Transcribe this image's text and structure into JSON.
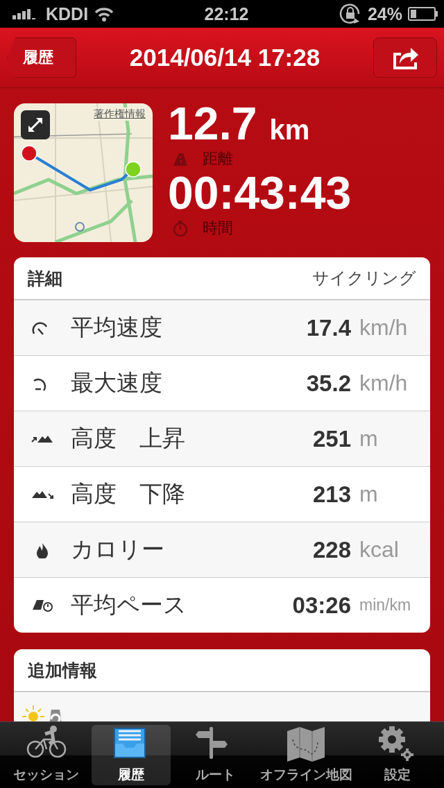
{
  "status_bar": {
    "carrier": "KDDI",
    "time": "22:12",
    "battery": "24%"
  },
  "nav": {
    "back": "履歴",
    "title": "2014/06/14 17:28"
  },
  "summary": {
    "map": {
      "credit": "著作権情報"
    },
    "stats": [
      {
        "kind": "distance",
        "value": "12.7",
        "unit": "km",
        "label": "距離"
      },
      {
        "kind": "time",
        "value": "00:43:43",
        "label": "時間"
      }
    ]
  },
  "details": {
    "title": "詳細",
    "activity": "サイクリング",
    "rows": [
      {
        "kind": "avg-speed",
        "label": "平均速度",
        "value": "17.4",
        "unit": "km/h"
      },
      {
        "kind": "max-speed",
        "label": "最大速度",
        "value": "35.2",
        "unit": "km/h"
      },
      {
        "kind": "ascent",
        "label": "高度　上昇",
        "value": "251",
        "unit": "m"
      },
      {
        "kind": "descent",
        "label": "高度　下降",
        "value": "213",
        "unit": "m"
      },
      {
        "kind": "calories",
        "label": "カロリー",
        "value": "228",
        "unit": "kcal"
      },
      {
        "kind": "pace",
        "label": "平均ペース",
        "value": "03:26",
        "unit": "min/km"
      }
    ]
  },
  "extra": {
    "title": "追加情報"
  },
  "tab_bar": [
    {
      "kind": "session",
      "label": "セッション",
      "selected": false
    },
    {
      "kind": "history",
      "label": "履歴",
      "selected": true
    },
    {
      "kind": "route",
      "label": "ルート",
      "selected": false
    },
    {
      "kind": "offline-map",
      "label": "オフライン地図",
      "selected": false
    },
    {
      "kind": "settings",
      "label": "設定",
      "selected": false
    }
  ]
}
